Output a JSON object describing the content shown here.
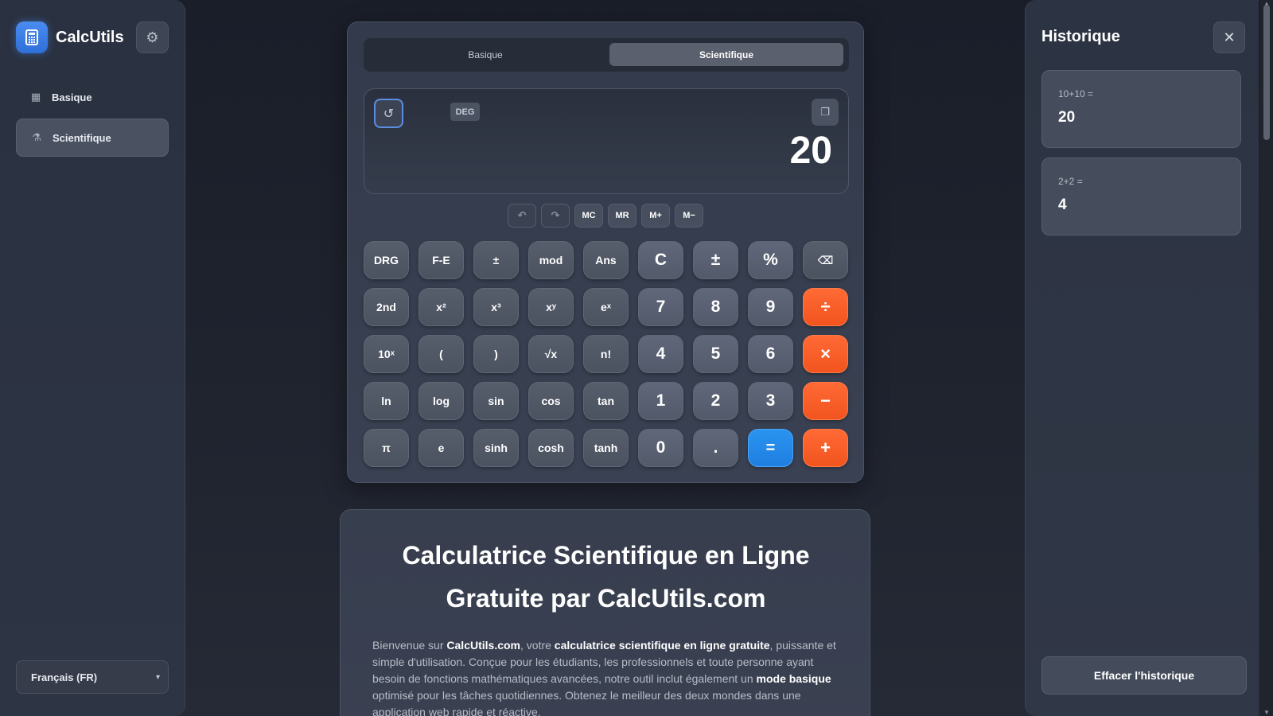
{
  "sidebar": {
    "app_name": "CalcUtils",
    "items": [
      {
        "label": "Basique"
      },
      {
        "label": "Scientifique"
      }
    ],
    "language": "Français (FR)"
  },
  "calculator": {
    "tabs": [
      "Basique",
      "Scientifique"
    ],
    "angle_mode": "DEG",
    "result": "20",
    "memory": [
      "MC",
      "MR",
      "M+",
      "M−"
    ],
    "keys": [
      "DRG",
      "F-E",
      "±",
      "mod",
      "Ans",
      "C",
      "±",
      "%",
      "⌫",
      "2nd",
      "x²",
      "x³",
      "xʸ",
      "eˣ",
      "7",
      "8",
      "9",
      "÷",
      "10ˣ",
      "(",
      ")",
      "√x",
      "n!",
      "4",
      "5",
      "6",
      "×",
      "ln",
      "log",
      "sin",
      "cos",
      "tan",
      "1",
      "2",
      "3",
      "−",
      "π",
      "e",
      "sinh",
      "cosh",
      "tanh",
      "0",
      ".",
      "=",
      "+"
    ]
  },
  "info": {
    "title": "Calculatrice Scientifique en Ligne Gratuite par CalcUtils.com",
    "p1": "Bienvenue sur ",
    "brand": "CalcUtils.com",
    "p2": ", votre ",
    "strong1": "calculatrice scientifique en ligne gratuite",
    "p3": ", puissante et simple d'utilisation. Conçue pour les étudiants, les professionnels et toute personne ayant besoin de fonctions mathématiques avancées, notre outil inclut également un ",
    "strong2": "mode basique",
    "p4": " optimisé pour les tâches quotidiennes. Obtenez le meilleur des deux mondes dans une application web rapide et réactive."
  },
  "history": {
    "title": "Historique",
    "entries": [
      {
        "expr": "10+10 =",
        "value": "20"
      },
      {
        "expr": "2+2 =",
        "value": "4"
      }
    ],
    "clear_label": "Effacer l'historique"
  }
}
